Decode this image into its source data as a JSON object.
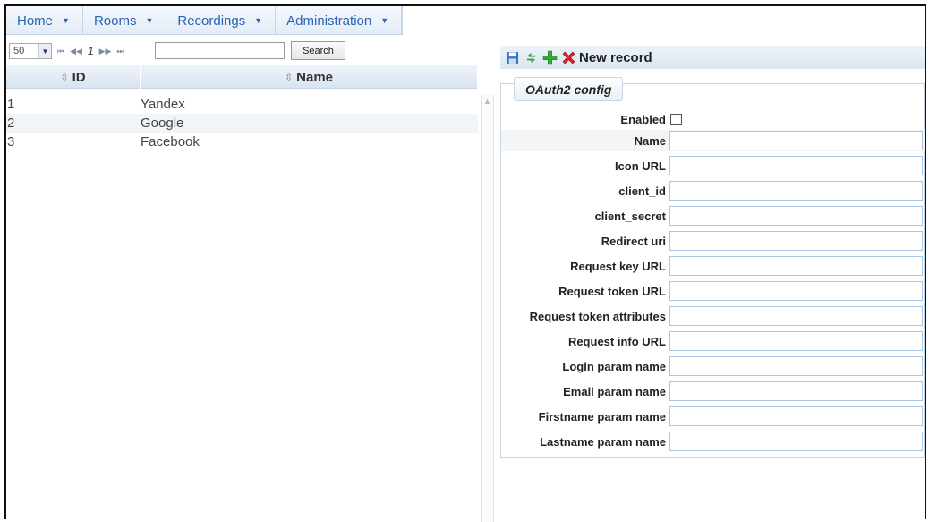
{
  "menu": {
    "items": [
      {
        "label": "Home"
      },
      {
        "label": "Rooms"
      },
      {
        "label": "Recordings"
      },
      {
        "label": "Administration"
      }
    ]
  },
  "grid": {
    "page_size": "50",
    "page_number": "1",
    "search_value": "",
    "search_label": "Search",
    "columns": {
      "id": "ID",
      "name": "Name"
    },
    "rows": [
      {
        "id": "1",
        "name": "Yandex"
      },
      {
        "id": "2",
        "name": "Google"
      },
      {
        "id": "3",
        "name": "Facebook"
      }
    ]
  },
  "form": {
    "toolbar_title": "New record",
    "tab_label": "OAuth2 config",
    "enabled_label": "Enabled",
    "fields": [
      {
        "label": "Name",
        "value": ""
      },
      {
        "label": "Icon URL",
        "value": ""
      },
      {
        "label": "client_id",
        "value": ""
      },
      {
        "label": "client_secret",
        "value": ""
      },
      {
        "label": "Redirect uri",
        "value": ""
      },
      {
        "label": "Request key URL",
        "value": ""
      },
      {
        "label": "Request token URL",
        "value": ""
      },
      {
        "label": "Request token attributes",
        "value": ""
      },
      {
        "label": "Request info URL",
        "value": ""
      },
      {
        "label": "Login param name",
        "value": ""
      },
      {
        "label": "Email param name",
        "value": ""
      },
      {
        "label": "Firstname param name",
        "value": ""
      },
      {
        "label": "Lastname param name",
        "value": ""
      }
    ]
  },
  "icons": {
    "save": "save-icon",
    "refresh": "refresh-icon",
    "add": "add-icon",
    "delete": "delete-icon"
  },
  "colors": {
    "menu_text": "#2a63b0",
    "header_bg": "#dbe6f1",
    "add_green": "#3aa63a",
    "delete_red": "#d9262b"
  }
}
